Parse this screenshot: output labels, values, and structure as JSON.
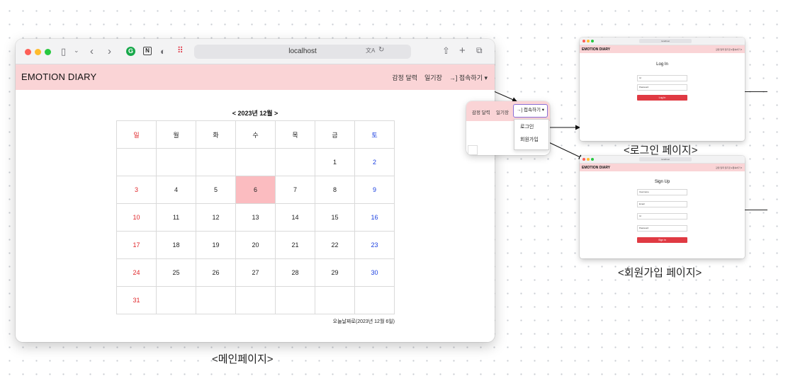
{
  "main_window": {
    "url": "localhost",
    "brand": "EMOTION DIARY",
    "nav": [
      "감정 달력",
      "일기장",
      "→] 접속하기 ▾"
    ],
    "calendar": {
      "title": "< 2023년 12월 >",
      "weekdays": [
        "일",
        "월",
        "화",
        "수",
        "목",
        "금",
        "토"
      ],
      "weeks": [
        [
          "",
          "",
          "",
          "",
          "",
          "1",
          "2"
        ],
        [
          "3",
          "4",
          "5",
          "6",
          "7",
          "8",
          "9"
        ],
        [
          "10",
          "11",
          "12",
          "13",
          "14",
          "15",
          "16"
        ],
        [
          "17",
          "18",
          "19",
          "20",
          "21",
          "22",
          "23"
        ],
        [
          "24",
          "25",
          "26",
          "27",
          "28",
          "29",
          "30"
        ],
        [
          "31",
          "",
          "",
          "",
          "",
          "",
          ""
        ]
      ],
      "today": "6",
      "footnote": "오늘날짜로(2023년 12월 6일)"
    }
  },
  "popup": {
    "nav1": "감정 달력",
    "nav2": "일기장",
    "button": "→] 접속하기 ▾",
    "menu": [
      "로그인",
      "회원가입"
    ]
  },
  "login_page": {
    "brand": "EMOTION DIARY",
    "url": "localhost",
    "nav": "감정 달력  일기장  ●접속하기 ▾",
    "title": "Log In",
    "fields": [
      "Id",
      "Password"
    ],
    "button": "Log In",
    "caption": "<로그인 페이지>"
  },
  "signup_page": {
    "brand": "EMOTION DIARY",
    "url": "localhost",
    "nav": "감정 달력  일기장  ●접속하기 ▾",
    "title": "Sign Up",
    "fields": [
      "Username",
      "Email",
      "Id",
      "Password"
    ],
    "button": "Sign in",
    "caption": "<회원가입 페이지>"
  },
  "main_caption": "<메인페이지>",
  "colors": {
    "header_pink": "#fad4d6",
    "today_pink": "#fbbcc0",
    "sunday": "#e0262a",
    "saturday": "#1a3fe0",
    "button_red": "#e03a43"
  }
}
